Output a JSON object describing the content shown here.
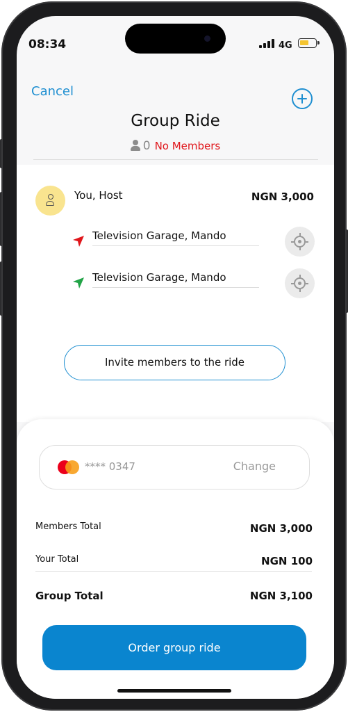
{
  "status_bar": {
    "time": "08:34",
    "network": "4G",
    "battery_level": 0.55,
    "battery_color": "#f4c430"
  },
  "header": {
    "cancel_label": "Cancel",
    "add_icon": "plus-circle-icon",
    "title": "Group Ride",
    "member_count": "0",
    "member_status": "No Members"
  },
  "host": {
    "avatar_icon": "user-icon",
    "name": "You, Host",
    "price": "NGN 3,000",
    "pickup": {
      "icon": "red-arrow-icon",
      "value": "Television Garage, Mando"
    },
    "dropoff": {
      "icon": "green-arrow-icon",
      "value": "Television Garage, Mando"
    },
    "locate_icon": "locate-target-icon"
  },
  "invite_label": "Invite members to the ride",
  "payment": {
    "card_brand_icon": "mastercard-icon",
    "card_number": "**** 0347",
    "change_label": "Change"
  },
  "summary": {
    "members_total_label": "Members Total",
    "members_total_value": "NGN 3,000",
    "your_total_label": "Your Total",
    "your_total_value": "NGN 100",
    "group_total_label": "Group Total",
    "group_total_value": "NGN 3,100"
  },
  "order_label": "Order group ride",
  "colors": {
    "accent": "#1f8fd1",
    "primary_button": "#0a85cf",
    "alert": "#e0161b",
    "avatar_bg": "#f9e48f"
  }
}
